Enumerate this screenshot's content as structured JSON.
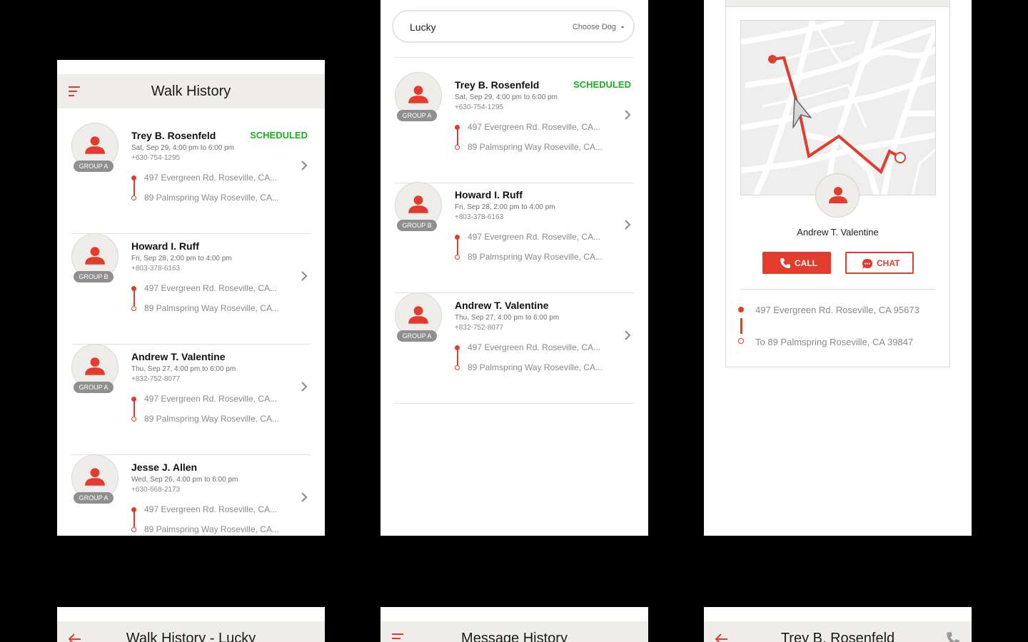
{
  "colors": {
    "accent": "#e33b2e",
    "scheduled": "#19b31d",
    "bar": "#efede9"
  },
  "walk_history": {
    "title": "Walk History",
    "menu_icon": "hamburger-icon",
    "items": [
      {
        "name": "Trey B. Rosenfeld",
        "status": "SCHEDULED",
        "when": "Sat, Sep 29, 4:00 pm to 6:00 pm",
        "phone": "+630-754-1295",
        "group": "GROUP A",
        "from": "497 Evergreen Rd. Roseville, CA...",
        "to": "89 Palmspring Way Roseville, CA..."
      },
      {
        "name": "Howard I. Ruff",
        "status": "",
        "when": "Fri, Sep 28, 2:00 pm to 4:00 pm",
        "phone": "+803-378-6163",
        "group": "GROUP B",
        "from": "497 Evergreen Rd. Roseville, CA...",
        "to": "89 Palmspring Way Roseville, CA..."
      },
      {
        "name": "Andrew T. Valentine",
        "status": "",
        "when": "Thu, Sep 27, 4:00 pm to 6:00 pm",
        "phone": "+832-752-8077",
        "group": "GROUP A",
        "from": "497 Evergreen Rd. Roseville, CA...",
        "to": "89 Palmspring Way Roseville, CA..."
      },
      {
        "name": "Jesse J. Allen",
        "status": "",
        "when": "Wed, Sep 26, 4:00 pm to 6:00 pm",
        "phone": "+630-668-2173",
        "group": "GROUP A",
        "from": "497 Evergreen Rd. Roseville, CA...",
        "to": "89 Palmspring Way Roseville, CA..."
      }
    ]
  },
  "dog_filter": {
    "search_value": "Lucky",
    "choose_label": "Choose Dog",
    "items": [
      {
        "name": "Trey B. Rosenfeld",
        "status": "SCHEDULED",
        "when": "Sat, Sep 29, 4:00 pm to 6:00 pm",
        "phone": "+630-754-1295",
        "group": "GROUP A",
        "from": "497 Evergreen Rd. Roseville, CA...",
        "to": "89 Palmspring Way Roseville, CA..."
      },
      {
        "name": "Howard I. Ruff",
        "status": "",
        "when": "Fri, Sep 28, 2:00 pm to 4:00 pm",
        "phone": "+803-378-6163",
        "group": "GROUP B",
        "from": "497 Evergreen Rd. Roseville, CA...",
        "to": "89 Palmspring Way Roseville, CA..."
      },
      {
        "name": "Andrew T. Valentine",
        "status": "",
        "when": "Thu, Sep 27, 4:00 pm to 6:00 pm",
        "phone": "+832-752-8077",
        "group": "GROUP A",
        "from": "497 Evergreen Rd. Roseville, CA...",
        "to": "89 Palmspring Way Roseville, CA..."
      }
    ]
  },
  "walk_detail": {
    "walker_name": "Andrew T. Valentine",
    "call_label": "CALL",
    "chat_label": "CHAT",
    "from": "497 Evergreen Rd. Roseville, CA 95673",
    "to": "To 89 Palmspring Roseville, CA 39847"
  },
  "bottom_screens": {
    "walk_history_lucky_title": "Walk History - Lucky",
    "message_history_title": "Message History",
    "contact_title": "Trey B. Rosenfeld"
  }
}
